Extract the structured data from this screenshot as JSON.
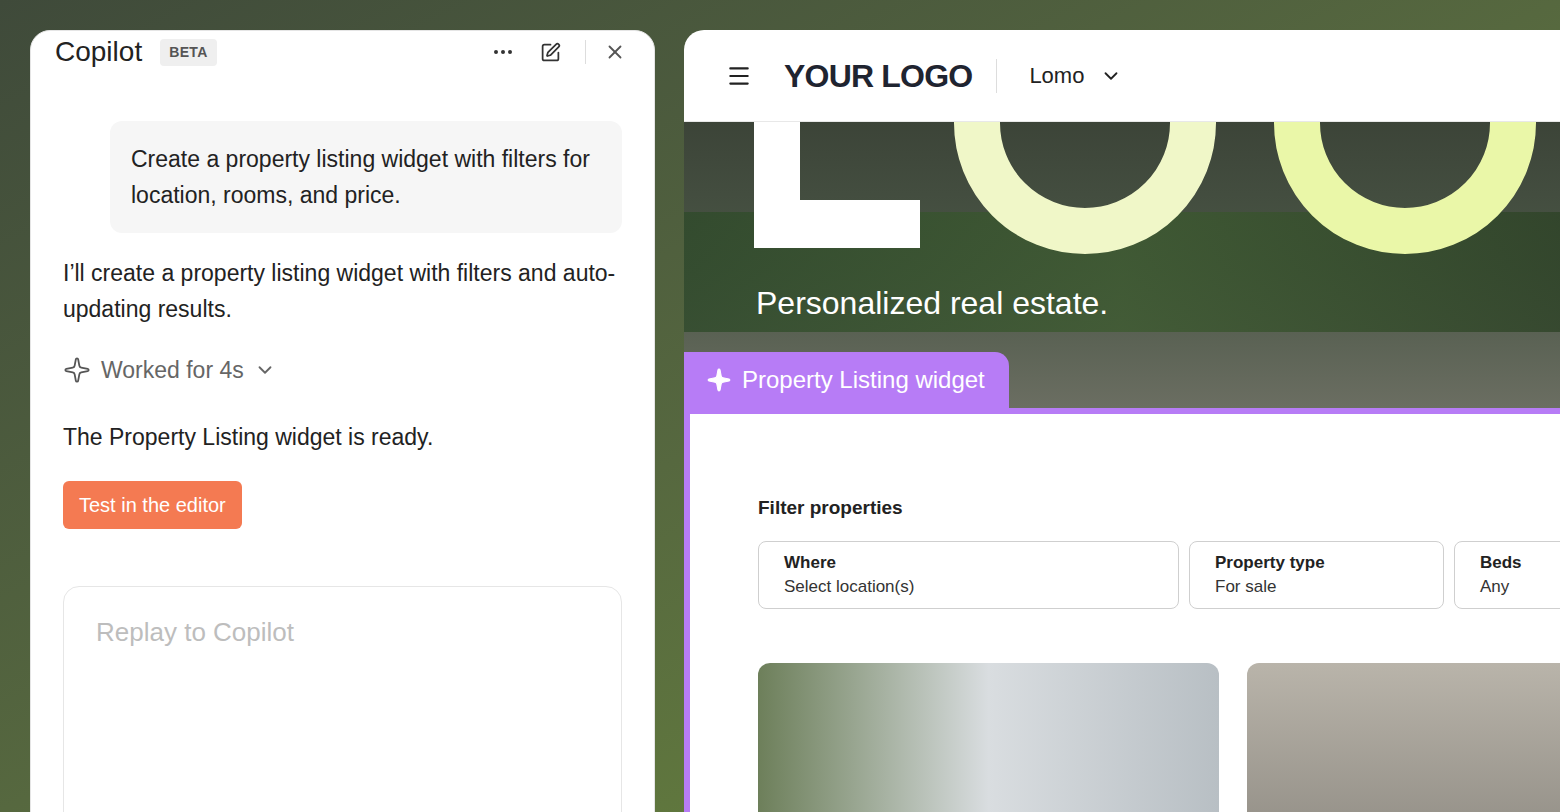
{
  "copilot": {
    "title": "Copilot",
    "badge": "BETA",
    "user_message": "Create a property listing widget with filters for location, rooms, and price.",
    "assistant_intro": "I’ll create a property listing widget with filters and auto-updating results.",
    "work_status": {
      "label": "Worked for 4s",
      "expanded": false
    },
    "assistant_result": "The Property Listing widget is ready.",
    "action_button": "Test in the editor",
    "input_placeholder": "Replay to Copilot"
  },
  "site": {
    "logo": "YOUR LOGO",
    "workspace": "Lomo",
    "tagline": "Personalized real estate."
  },
  "widget": {
    "tab": "Property Listing widget",
    "filter_title": "Filter properties",
    "filters": [
      {
        "label": "Where",
        "value": "Select location(s)"
      },
      {
        "label": "Property type",
        "value": "For sale"
      },
      {
        "label": "Beds",
        "value": "Any"
      }
    ]
  }
}
